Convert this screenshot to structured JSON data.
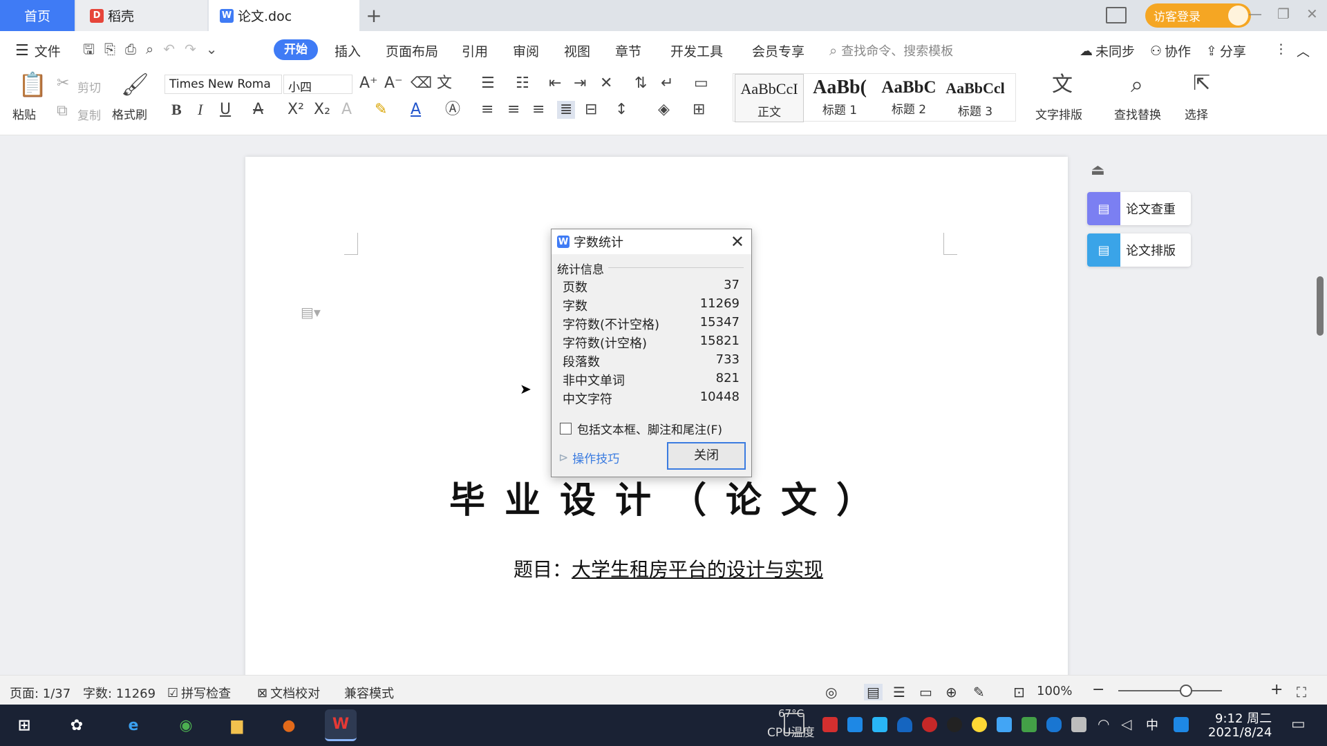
{
  "tabs": {
    "home": "首页",
    "daoke": "稻壳",
    "document": "论文.doc",
    "new_tab": "+"
  },
  "titlebar": {
    "login": "访客登录"
  },
  "menu": {
    "file": "文件",
    "items": [
      "开始",
      "插入",
      "页面布局",
      "引用",
      "审阅",
      "视图",
      "章节",
      "开发工具",
      "会员专享"
    ],
    "search_placeholder": "查找命令、搜索模板",
    "unsynced": "未同步",
    "collaborate": "协作",
    "share": "分享"
  },
  "ribbon": {
    "paste": "粘贴",
    "cut": "剪切",
    "copy": "复制",
    "format_painter": "格式刷",
    "font_name": "Times New Roma",
    "font_size": "小四",
    "styles": [
      {
        "sample": "AaBbCcI",
        "name": "正文"
      },
      {
        "sample": "AaBb(",
        "name": "标题 1"
      },
      {
        "sample": "AaBbC",
        "name": "标题 2"
      },
      {
        "sample": "AaBbCcl",
        "name": "标题 3"
      }
    ],
    "text_layout": "文字排版",
    "find_replace": "查找替换",
    "select": "选择"
  },
  "side_panel": {
    "check": "论文查重",
    "format": "论文排版"
  },
  "document": {
    "title": "毕业设计（论文）",
    "topic_label": "题目：",
    "topic_value": "大学生租房平台的设计与实现"
  },
  "dialog": {
    "title": "字数统计",
    "group": "统计信息",
    "stats": [
      {
        "label": "页数",
        "value": "37"
      },
      {
        "label": "字数",
        "value": "11269"
      },
      {
        "label": "字符数(不计空格)",
        "value": "15347"
      },
      {
        "label": "字符数(计空格)",
        "value": "15821"
      },
      {
        "label": "段落数",
        "value": "733"
      },
      {
        "label": "非中文单词",
        "value": "821"
      },
      {
        "label": "中文字符",
        "value": "10448"
      }
    ],
    "include_checkbox": "包括文本框、脚注和尾注(F)",
    "tips": "操作技巧",
    "close": "关闭"
  },
  "statusbar": {
    "page": "页面: 1/37",
    "words": "字数: 11269",
    "spell": "拼写检查",
    "proof": "文档校对",
    "compat": "兼容模式",
    "zoom": "100%"
  },
  "taskbar": {
    "cpu_temp": "67°C",
    "cpu_label": "CPU温度",
    "ime": "中",
    "time": "9:12 周二",
    "date": "2021/8/24"
  },
  "colors": {
    "accent": "#3f7bf5",
    "login": "#f5a623",
    "taskbar": "#1a2234"
  }
}
